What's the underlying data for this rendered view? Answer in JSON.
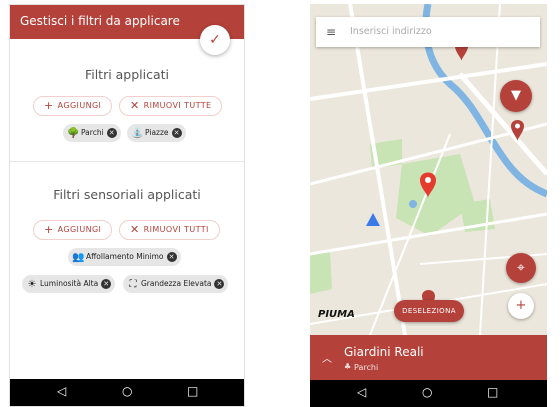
{
  "left_screen": {
    "title": "Gestisci i filtri da applicare",
    "confirm_icon": "✓",
    "applied": {
      "title": "Filtri applicati",
      "add_label": "AGGIUNGI",
      "remove_label": "RIMUOVI TUTTE",
      "chips": [
        {
          "label": "Parchi",
          "icon": "tree-icon",
          "glyph": "🌳"
        },
        {
          "label": "Piazze",
          "icon": "plaza-icon",
          "glyph": "⛲"
        }
      ]
    },
    "sensorial": {
      "title": "Filtri sensoriali applicati",
      "add_label": "AGGIUNGI",
      "remove_label": "RIMUOVI TUTTI",
      "chips": [
        {
          "label": "Affollamento Minimo",
          "icon": "people-icon",
          "glyph": "👥"
        },
        {
          "label": "Luminosità Alta",
          "icon": "brightness-icon",
          "glyph": "☀"
        },
        {
          "label": "Grandezza Elevata",
          "icon": "size-icon",
          "glyph": "⛶"
        }
      ]
    }
  },
  "right_screen": {
    "search_placeholder": "Inserisci indirizzo",
    "deselect_label": "DESELEZIONA",
    "brand": "PIUMA",
    "place_name": "Giardini Reali",
    "place_category": "Parchi"
  },
  "nav": {
    "back": "◁",
    "home": "○",
    "recents": "□"
  },
  "colors": {
    "accent": "#b5423a",
    "map_bg": "#ece7dc",
    "park": "#c8e3b4",
    "water": "#7fb4e3"
  }
}
